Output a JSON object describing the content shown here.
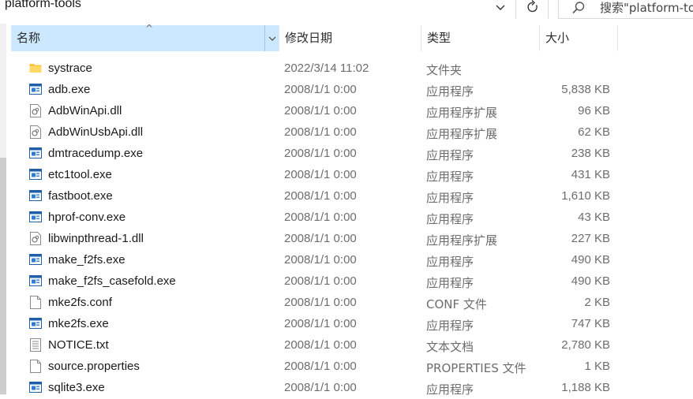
{
  "address": {
    "folder": "platform-tools"
  },
  "search": {
    "placeholder": "搜索\"platform-tools\""
  },
  "columns": {
    "name": "名称",
    "date": "修改日期",
    "type": "类型",
    "size": "大小"
  },
  "files": [
    {
      "name": "systrace",
      "date": "2022/3/14 11:02",
      "type": "文件夹",
      "size": "",
      "icon": "folder-icon"
    },
    {
      "name": "adb.exe",
      "date": "2008/1/1 0:00",
      "type": "应用程序",
      "size": "5,838 KB",
      "icon": "exe-icon"
    },
    {
      "name": "AdbWinApi.dll",
      "date": "2008/1/1 0:00",
      "type": "应用程序扩展",
      "size": "96 KB",
      "icon": "dll-icon"
    },
    {
      "name": "AdbWinUsbApi.dll",
      "date": "2008/1/1 0:00",
      "type": "应用程序扩展",
      "size": "62 KB",
      "icon": "dll-icon"
    },
    {
      "name": "dmtracedump.exe",
      "date": "2008/1/1 0:00",
      "type": "应用程序",
      "size": "238 KB",
      "icon": "exe-icon"
    },
    {
      "name": "etc1tool.exe",
      "date": "2008/1/1 0:00",
      "type": "应用程序",
      "size": "431 KB",
      "icon": "exe-icon"
    },
    {
      "name": "fastboot.exe",
      "date": "2008/1/1 0:00",
      "type": "应用程序",
      "size": "1,610 KB",
      "icon": "exe-icon"
    },
    {
      "name": "hprof-conv.exe",
      "date": "2008/1/1 0:00",
      "type": "应用程序",
      "size": "43 KB",
      "icon": "exe-icon"
    },
    {
      "name": "libwinpthread-1.dll",
      "date": "2008/1/1 0:00",
      "type": "应用程序扩展",
      "size": "227 KB",
      "icon": "dll-icon"
    },
    {
      "name": "make_f2fs.exe",
      "date": "2008/1/1 0:00",
      "type": "应用程序",
      "size": "490 KB",
      "icon": "exe-icon"
    },
    {
      "name": "make_f2fs_casefold.exe",
      "date": "2008/1/1 0:00",
      "type": "应用程序",
      "size": "490 KB",
      "icon": "exe-icon"
    },
    {
      "name": "mke2fs.conf",
      "date": "2008/1/1 0:00",
      "type": "CONF 文件",
      "size": "2 KB",
      "icon": "file-icon"
    },
    {
      "name": "mke2fs.exe",
      "date": "2008/1/1 0:00",
      "type": "应用程序",
      "size": "747 KB",
      "icon": "exe-icon"
    },
    {
      "name": "NOTICE.txt",
      "date": "2008/1/1 0:00",
      "type": "文本文档",
      "size": "2,780 KB",
      "icon": "txt-icon"
    },
    {
      "name": "source.properties",
      "date": "2008/1/1 0:00",
      "type": "PROPERTIES 文件",
      "size": "1 KB",
      "icon": "file-icon"
    },
    {
      "name": "sqlite3.exe",
      "date": "2008/1/1 0:00",
      "type": "应用程序",
      "size": "1,188 KB",
      "icon": "exe-icon"
    }
  ]
}
